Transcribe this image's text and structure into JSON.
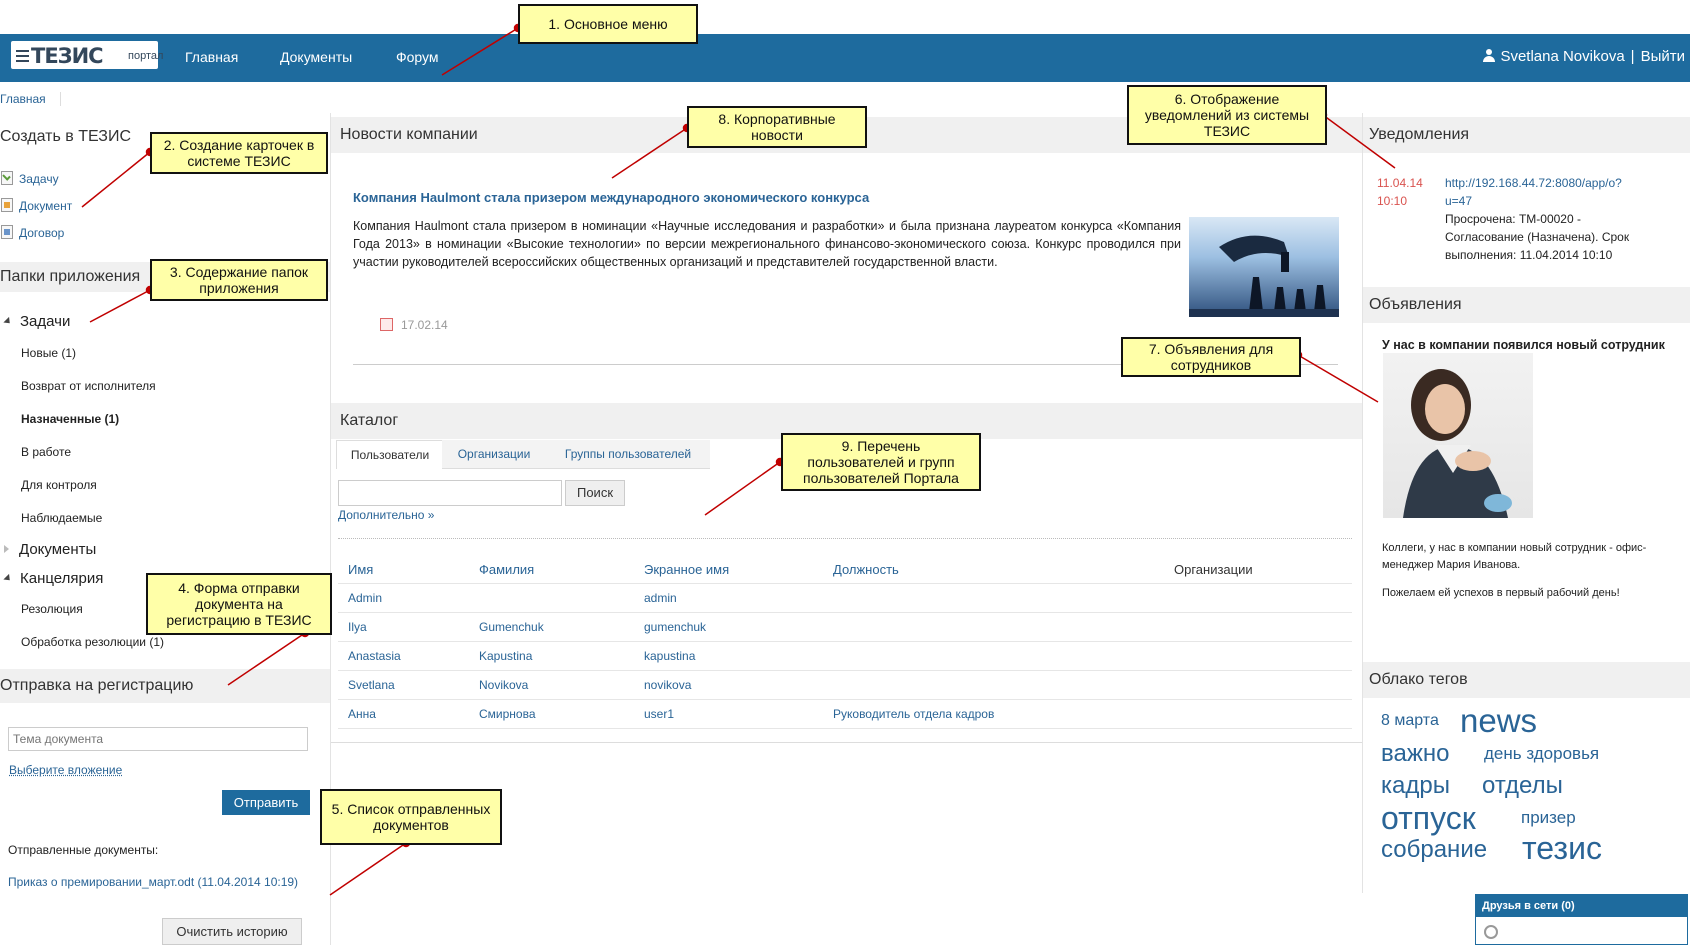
{
  "header": {
    "logo_text": "ТЕЗИС",
    "logo_sub": "портал",
    "nav": [
      "Главная",
      "Документы",
      "Форум"
    ],
    "user_name": "Svetlana Novikova",
    "separator": "|",
    "logout": "Выйти"
  },
  "breadcrumb": "Главная",
  "create": {
    "title": "Создать в ТЕЗИС",
    "items": [
      "Задачу",
      "Документ",
      "Договор"
    ]
  },
  "folders": {
    "title": "Папки приложения",
    "tasks_label": "Задачи",
    "task_items": [
      "Новые (1)",
      "Возврат от исполнителя",
      "Назначенные (1)",
      "В работе",
      "Для контроля",
      "Наблюдаемые"
    ],
    "documents_label": "Документы",
    "office_label": "Канцелярия",
    "office_items": [
      "Резолюция",
      "Обработка резолюции (1)"
    ]
  },
  "registration": {
    "title": "Отправка на регистрацию",
    "subject_placeholder": "Тема документа",
    "attach_link": "Выберите вложение",
    "send_button": "Отправить",
    "sent_label": "Отправленные документы:",
    "sent_item": "Приказ о премировании_март.odt (11.04.2014 10:19)",
    "clear_button": "Очистить историю"
  },
  "news": {
    "title": "Новости компании",
    "headline": "Компания Haulmont стала призером международного экономического конкурса",
    "body": "Компания Haulmont стала призером в номинации «Научные исследования и разработки» и была признана лауреатом конкурса «Компания Года 2013» в номинации «Высокие технологии» по версии межрегионального финансово-экономического союза. Конкурс проводился при участии руководителей всероссийских общественных организаций и представителей государственной власти.",
    "date": "17.02.14"
  },
  "catalog": {
    "title": "Каталог",
    "tabs": [
      "Пользователи",
      "Организации",
      "Группы пользователей"
    ],
    "search_button": "Поиск",
    "more_link": "Дополнительно »",
    "columns": [
      "Имя",
      "Фамилия",
      "Экранное имя",
      "Должность",
      "Организации"
    ],
    "rows": [
      {
        "first": "Admin",
        "last": "",
        "screen": "admin",
        "position": ""
      },
      {
        "first": "Ilya",
        "last": "Gumenchuk",
        "screen": "gumenchuk",
        "position": ""
      },
      {
        "first": "Anastasia",
        "last": "Kapustina",
        "screen": "kapustina",
        "position": ""
      },
      {
        "first": "Svetlana",
        "last": "Novikova",
        "screen": "novikova",
        "position": ""
      },
      {
        "first": "Анна",
        "last": "Смирнова",
        "screen": "user1",
        "position": "Руководитель отдела кадров"
      }
    ]
  },
  "notifications": {
    "title": "Уведомления",
    "date": "11.04.14",
    "time": "10:10",
    "link1": "http://192.168.44.72:8080/app/o?",
    "link2": "u=47",
    "text1": "Просрочена: ТМ-00020 -",
    "text2": "Согласование (Назначена). Срок",
    "text3": "выполнения: 11.04.2014 10:10"
  },
  "announcements": {
    "title": "Объявления",
    "headline": "У нас в компании появился новый сотрудник",
    "text1": "Коллеги, у нас в компании новый сотрудник - офис-менеджер Мария Иванова.",
    "text2": "Пожелаем ей успехов в первый рабочий день!"
  },
  "tags": {
    "title": "Облако тегов",
    "items": [
      "8 марта",
      "news",
      "важно",
      "день здоровья",
      "кадры",
      "отделы",
      "отпуск",
      "призер",
      "собрание",
      "тезис"
    ]
  },
  "friends": {
    "title": "Друзья в сети (0)"
  },
  "callouts": [
    "1. Основное меню",
    "2. Создание карточек в системе ТЕЗИС",
    "3. Содержание папок приложения",
    "4. Форма отправки документа на регистрацию в ТЕЗИС",
    "5. Список отправленных документов",
    "6. Отображение уведомлений из системы ТЕЗИС",
    "7. Объявления для сотрудников",
    "8. Корпоративные новости",
    "9. Перечень пользователей и групп пользователей Портала"
  ],
  "colors": {
    "topbar": "#1e6b9e",
    "link": "#2a6496",
    "callout": "#ffffa8",
    "date_red": "#d9534f"
  }
}
